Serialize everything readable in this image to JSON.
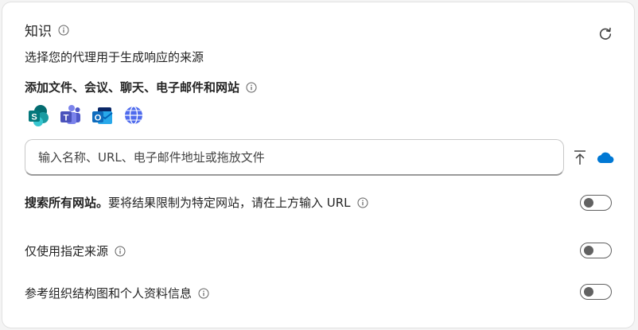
{
  "knowledge": {
    "title": "知识",
    "subtitle": "选择您的代理用于生成响应的来源",
    "add_section_label": "添加文件、会议、聊天、电子邮件和网站",
    "sources": [
      {
        "name": "SharePoint",
        "icon": "sharepoint-icon",
        "letter": "S",
        "color": "#03787c"
      },
      {
        "name": "Teams",
        "icon": "teams-icon",
        "letter": "T",
        "color": "#5b5fc7"
      },
      {
        "name": "Outlook",
        "icon": "outlook-icon",
        "letter": "O",
        "color": "#0f6cbd"
      },
      {
        "name": "Web",
        "icon": "globe-icon",
        "color": "#4f6bed"
      }
    ],
    "input_placeholder": "输入名称、URL、电子邮件地址或拖放文件",
    "search_all_bold": "搜索所有网站。",
    "search_all_rest": "要将结果限制为特定网站，请在上方输入 URL",
    "search_all_on": false,
    "only_specified_label": "仅使用指定来源",
    "only_specified_on": false,
    "org_chart_label": "参考组织结构图和个人资料信息",
    "org_chart_on": false
  },
  "colors": {
    "accent": "#0f6cbd",
    "cloud": "#0078d4",
    "toggle_off": "#616161"
  }
}
